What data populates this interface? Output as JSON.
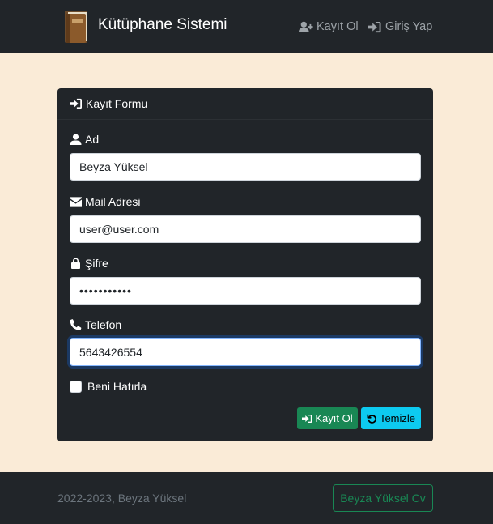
{
  "navbar": {
    "brand": "Kütüphane Sistemi",
    "register_link": "Kayıt Ol",
    "login_link": "Giriş Yap"
  },
  "form": {
    "title": "Kayıt Formu",
    "fields": {
      "name": {
        "label": "Ad",
        "value": "Beyza Yüksel"
      },
      "email": {
        "label": "Mail Adresi",
        "value": "user@user.com"
      },
      "password": {
        "label": "Şifre",
        "value": "•••••••••••"
      },
      "phone": {
        "label": "Telefon",
        "value": "5643426554"
      }
    },
    "remember_label": "Beni Hatırla",
    "register_button": "Kayıt Ol",
    "clear_button": "Temizle"
  },
  "footer": {
    "text": "2022-2023, Beyza Yüksel",
    "cv_button": "Beyza Yüksel Cv"
  },
  "colors": {
    "page_background": "#faebd7",
    "dark": "#212529",
    "success": "#198754",
    "info": "#0dcaf0"
  }
}
